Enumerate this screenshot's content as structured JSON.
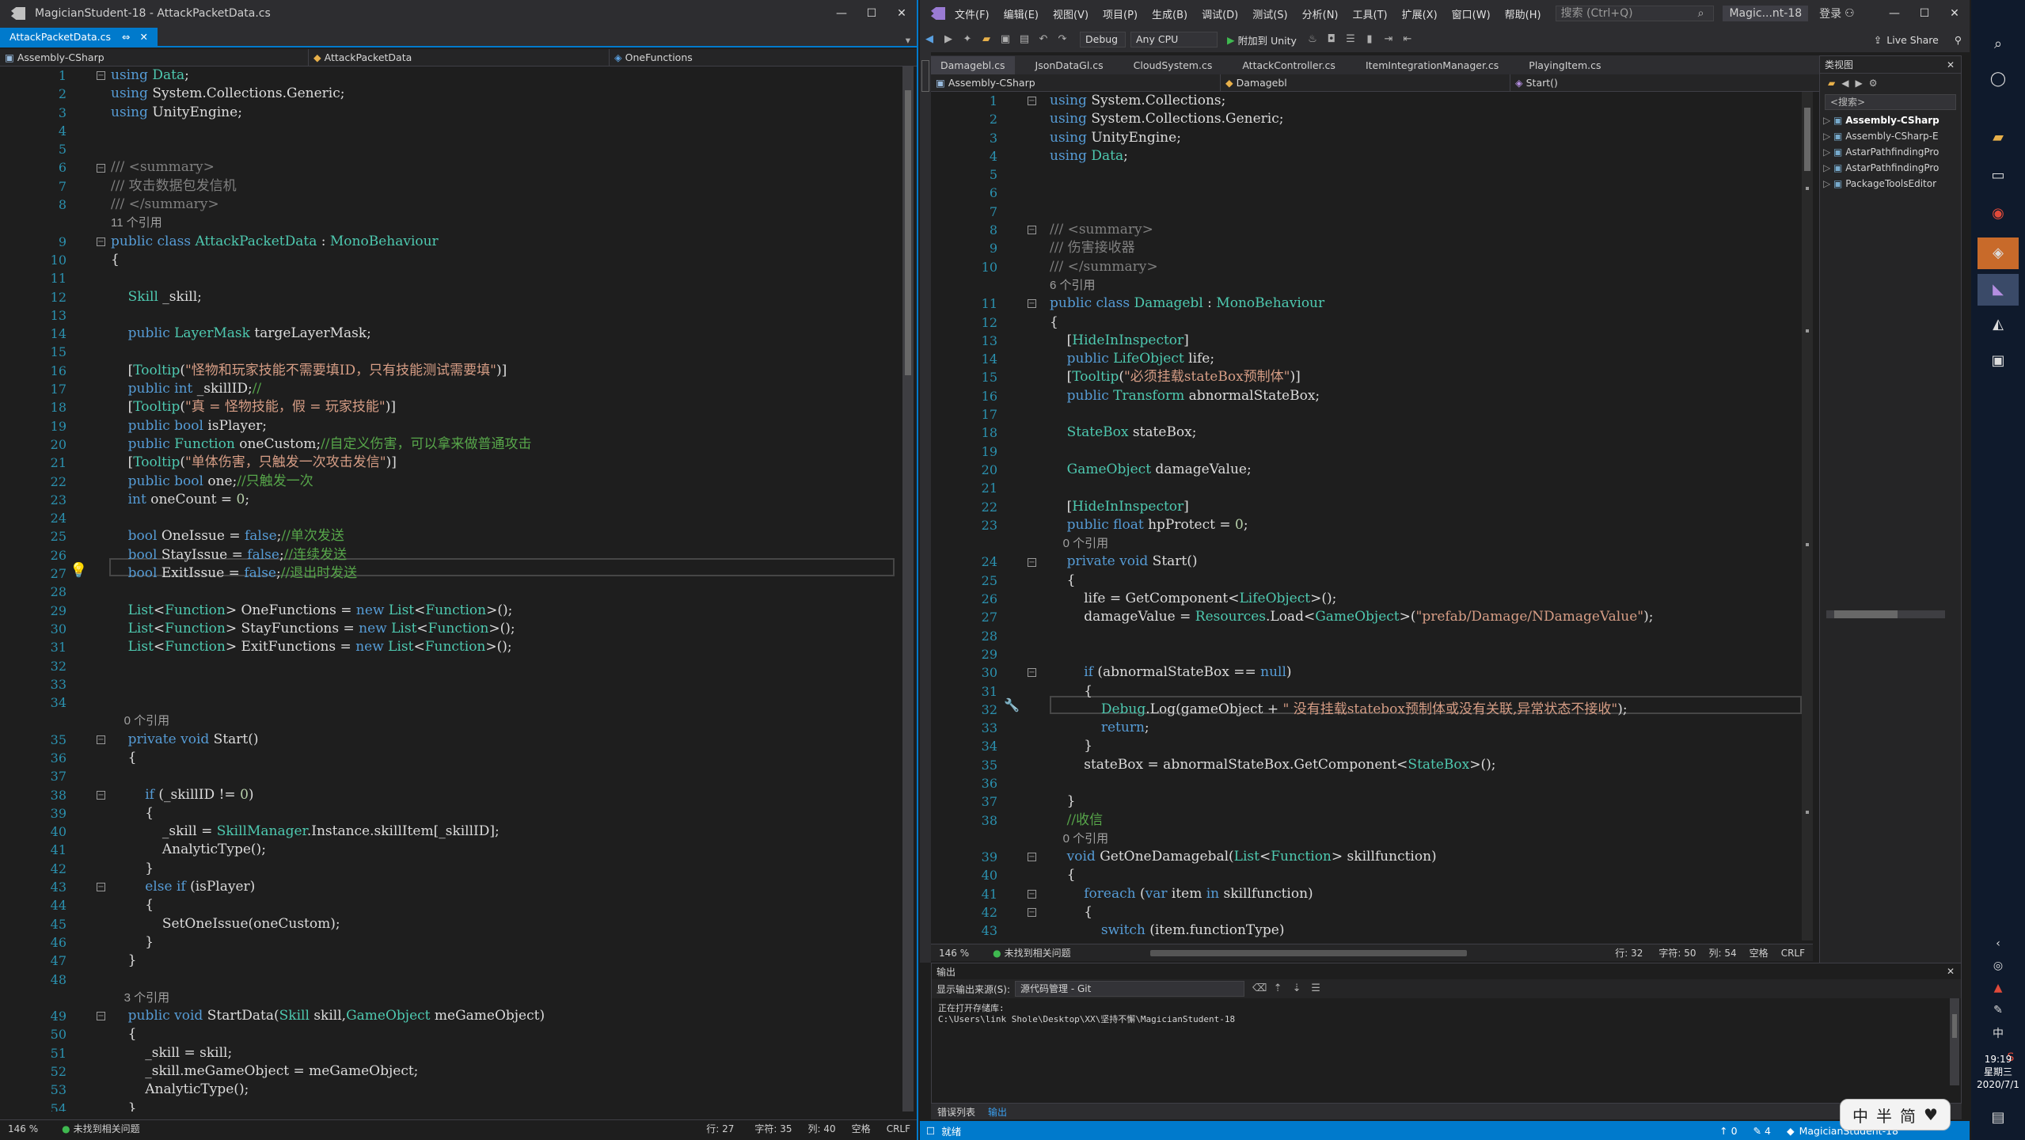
{
  "left": {
    "title": "MagicianStudent-18 - AttackPacketData.cs",
    "tab": "AttackPacketData.cs",
    "tab_pin": "⇔",
    "tab_close": "✕",
    "nav": {
      "project": "Assembly-CSharp",
      "class": "AttackPacketData",
      "member": "OneFunctions"
    },
    "lines": [
      "1",
      "2",
      "3",
      "4",
      "5",
      "6",
      "7",
      "8",
      "",
      "9",
      "10",
      "11",
      "12",
      "13",
      "14",
      "15",
      "16",
      "17",
      "18",
      "19",
      "20",
      "21",
      "22",
      "23",
      "24",
      "25",
      "26",
      "27",
      "28",
      "29",
      "30",
      "31",
      "32",
      "33",
      "34",
      "",
      "35",
      "36",
      "37",
      "38",
      "39",
      "40",
      "41",
      "42",
      "43",
      "44",
      "45",
      "46",
      "47",
      "48",
      "",
      "49",
      "50",
      "51",
      "52",
      "53",
      "54"
    ],
    "code": [
      "using Data;",
      "using System.Collections.Generic;",
      "using UnityEngine;",
      "",
      "",
      "/// <summary>",
      "/// 攻击数据包发信机",
      "/// </summary>",
      "11 个引用",
      "public class AttackPacketData : MonoBehaviour",
      "{",
      "",
      "    Skill _skill;",
      "",
      "    public LayerMask targeLayerMask;",
      "",
      "    [Tooltip(\"怪物和玩家技能不需要填ID，只有技能测试需要填\")]",
      "    public int _skillID;//",
      "    [Tooltip(\"真 = 怪物技能，假 = 玩家技能\")]",
      "    public bool isPlayer;",
      "    public Function oneCustom;//自定义伤害，可以拿来做普通攻击",
      "    [Tooltip(\"单体伤害，只触发一次攻击发信\")]",
      "    public bool one;//只触发一次",
      "    int oneCount = 0;",
      "",
      "    bool OneIssue = false;//单次发送",
      "    bool StayIssue = false;//连续发送",
      "    bool ExitIssue = false;//退出时发送",
      "",
      "    List<Function> OneFunctions = new List<Function>();",
      "    List<Function> StayFunctions = new List<Function>();",
      "    List<Function> ExitFunctions = new List<Function>();",
      "",
      "",
      "",
      "    0 个引用",
      "    private void Start()",
      "    {",
      "",
      "        if (_skillID != 0)",
      "        {",
      "            _skill = SkillManager.Instance.skillItem[_skillID];",
      "            AnalyticType();",
      "        }",
      "        else if (isPlayer)",
      "        {",
      "            SetOneIssue(oneCustom);",
      "        }",
      "    }",
      "",
      "    3 个引用",
      "    public void StartData(Skill skill,GameObject meGameObject)",
      "    {",
      "        _skill = skill;",
      "        _skill.meGameObject = meGameObject;",
      "        AnalyticType();",
      "    }"
    ],
    "status": {
      "zoom": "146 %",
      "issues": "未找到相关问题",
      "row": "行: 27",
      "char": "字符: 35",
      "col": "列: 40",
      "space": "空格",
      "eol": "CRLF"
    }
  },
  "right": {
    "title_short": "Magic...nt-18",
    "menu": [
      "文件(F)",
      "编辑(E)",
      "视图(V)",
      "项目(P)",
      "生成(B)",
      "调试(D)",
      "测试(S)",
      "分析(N)",
      "工具(T)",
      "扩展(X)",
      "窗口(W)",
      "帮助(H)"
    ],
    "search_placeholder": "搜索 (Ctrl+Q)",
    "login": "登录",
    "live_share": "Live Share",
    "config": "Debug",
    "platform": "Any CPU",
    "attach": "附加到 Unity",
    "tabs": [
      "Damagebl.cs",
      "JsonDataGl.cs",
      "CloudSystem.cs",
      "AttackController.cs",
      "ItemIntegrationManager.cs",
      "PlayingItem.cs"
    ],
    "nav": {
      "project": "Assembly-CSharp",
      "class": "Damagebl",
      "member": "Start()"
    },
    "lines": [
      "1",
      "2",
      "3",
      "4",
      "5",
      "6",
      "7",
      "8",
      "9",
      "10",
      "",
      "11",
      "12",
      "13",
      "14",
      "15",
      "16",
      "17",
      "18",
      "19",
      "20",
      "21",
      "22",
      "23",
      "",
      "24",
      "25",
      "26",
      "27",
      "28",
      "29",
      "30",
      "31",
      "32",
      "33",
      "34",
      "35",
      "36",
      "37",
      "38",
      "",
      "39",
      "40",
      "41",
      "42",
      "43"
    ],
    "code": [
      "using System.Collections;",
      "using System.Collections.Generic;",
      "using UnityEngine;",
      "using Data;",
      "",
      "",
      "",
      "/// <summary>",
      "/// 伤害接收器",
      "/// </summary>",
      "6 个引用",
      "public class Damagebl : MonoBehaviour",
      "{",
      "    [HideInInspector]",
      "    public LifeObject life;",
      "    [Tooltip(\"必须挂载stateBox预制体\")]",
      "    public Transform abnormalStateBox;",
      "",
      "    StateBox stateBox;",
      "",
      "    GameObject damageValue;",
      "",
      "    [HideInInspector]",
      "    public float hpProtect = 0;",
      "    0 个引用",
      "    private void Start()",
      "    {",
      "        life = GetComponent<LifeObject>();",
      "        damageValue = Resources.Load<GameObject>(\"prefab/Damage/NDamageValue\");",
      "",
      "",
      "        if (abnormalStateBox == null)",
      "        {",
      "            Debug.Log(gameObject + \" 没有挂载statebox预制体或没有关联,异常状态不接收\");",
      "            return;",
      "        }",
      "        stateBox = abnormalStateBox.GetComponent<StateBox>();",
      "",
      "    }",
      "    //收信",
      "    0 个引用",
      "    void GetOneDamagebal(List<Function> skillfunction)",
      "    {",
      "        foreach (var item in skillfunction)",
      "        {",
      "            switch (item.functionType)"
    ],
    "status": {
      "zoom": "146 %",
      "issues": "未找到相关问题",
      "row": "行: 32",
      "char": "字符: 50",
      "col": "列: 54",
      "space": "空格",
      "eol": "CRLF"
    },
    "output": {
      "title": "输出",
      "source_label": "显示输出来源(S):",
      "source": "源代码管理 - Git",
      "line1": "正在打开存储库:",
      "line2": "C:\\Users\\link Shole\\Desktop\\XX\\坚持不懈\\MagicianStudent-18"
    },
    "bottom_tabs": [
      "错误列表",
      "输出"
    ],
    "ready": "就绪",
    "git_up": "0",
    "git_edit": "4",
    "repo": "MagicianStudent-18",
    "solution": {
      "title": "类视图",
      "search": "<搜索>",
      "items": [
        "Assembly-CSharp",
        "Assembly-CSharp-E",
        "AstarPathfindingPro",
        "AstarPathfindingPro",
        "PackageToolsEditor"
      ]
    }
  },
  "taskbar": {
    "time": "19:19",
    "weekday": "星期三",
    "date": "2020/7/1",
    "ime_lang": "中",
    "ime": [
      "中",
      "半",
      "简"
    ]
  }
}
